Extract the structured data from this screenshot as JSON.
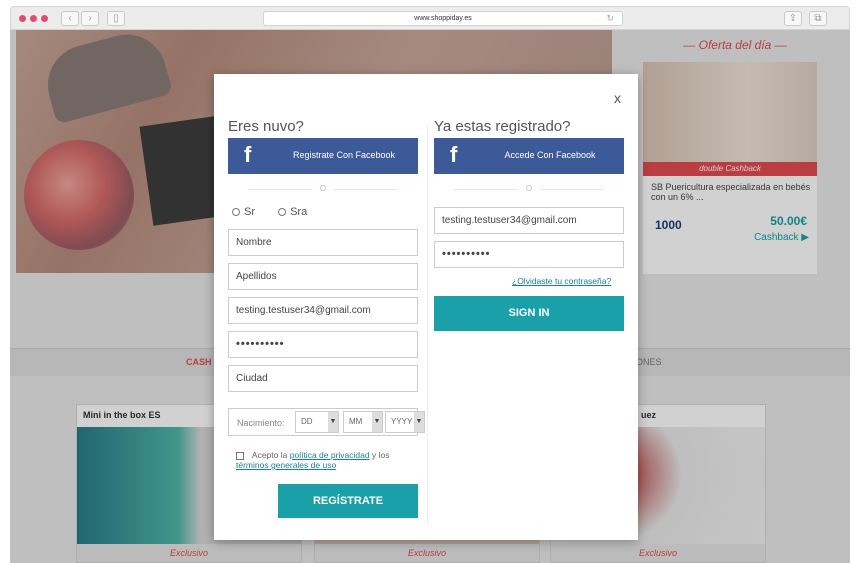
{
  "browser": {
    "url": "www.shoppiday.es",
    "reload_glyph": "↻",
    "back_glyph": "‹",
    "forward_glyph": "›",
    "sidebar_glyph": "▯",
    "share_glyph": "⇪",
    "tabs_glyph": "⧉"
  },
  "background": {
    "oferta_title": "— Oferta del día —",
    "oferta_band": "double Cashback",
    "oferta_desc": "SB Puericultura especializada en bebés con un 6% ...",
    "oferta_logo": "1000",
    "oferta_price": "50.00€",
    "oferta_cashback": "Cashback ▶",
    "tab_cash": "CASH",
    "tab_ones": "ONES",
    "card1_title": "Mini in the box ES",
    "card3_title": "uez",
    "exclusivo": "Exclusivo"
  },
  "modal": {
    "close": "x",
    "register": {
      "heading": "Eres nuvo?",
      "facebook_label": "Registrate Con Facebook",
      "or": "O",
      "sr": "Sr",
      "sra": "Sra",
      "nombre": "Nombre",
      "apellidos": "Apellidos",
      "email": "testing.testuser34@gmail.com",
      "password": "••••••••••",
      "ciudad": "Ciudad",
      "birth_label": "Nacimiento:",
      "dd": "DD",
      "mm": "MM",
      "yyyy": "YYYY",
      "terms_prefix": "Acepto la",
      "terms_policy": "política de privacidad",
      "terms_and": "y los",
      "terms_general": "términos generales de uso",
      "submit": "REGÍSTRATE"
    },
    "login": {
      "heading": "Ya estas registrado?",
      "facebook_label": "Accede Con Facebook",
      "or": "O",
      "email": "testing.testuser34@gmail.com",
      "password": "••••••••••",
      "forgot": "¿Olvidaste tu contraseña?",
      "submit": "SIGN IN"
    }
  }
}
